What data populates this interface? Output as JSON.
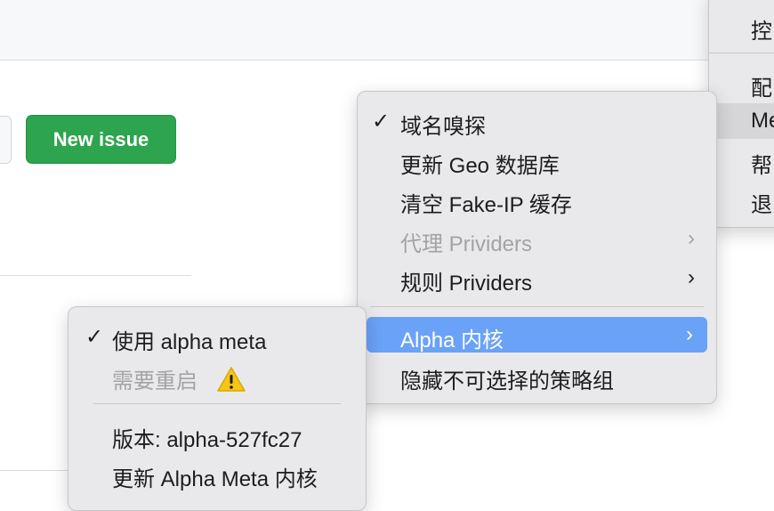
{
  "page": {
    "new_issue_label": "New issue"
  },
  "right_menu": {
    "items": [
      "控",
      "配",
      "Me",
      "帮",
      "退"
    ]
  },
  "main_menu": {
    "items": [
      {
        "label": "域名嗅探",
        "checked": true
      },
      {
        "label": "更新 Geo 数据库"
      },
      {
        "label": "清空 Fake-IP 缓存"
      },
      {
        "label": "代理 Prividers",
        "disabled": true,
        "submenu": true
      },
      {
        "label": "规则 Prividers",
        "submenu": true
      },
      {
        "label": "Alpha 内核",
        "submenu": true,
        "active": true
      },
      {
        "label": "隐藏不可选择的策略组"
      }
    ],
    "check_glyph": "✓",
    "chevron_glyph": "›"
  },
  "sub_menu": {
    "items": [
      {
        "label": "使用 alpha meta",
        "checked": true
      },
      {
        "label": "需要重启",
        "disabled": true,
        "icon": "warning-icon"
      },
      {
        "label": "版本: alpha-527fc27"
      },
      {
        "label": "更新 Alpha Meta 内核"
      }
    ]
  },
  "colors": {
    "primary_green": "#2da44e",
    "highlight_blue": "#6aa2f7",
    "menu_bg": "#e9e9eb",
    "warning_yellow": "#f5c518"
  }
}
